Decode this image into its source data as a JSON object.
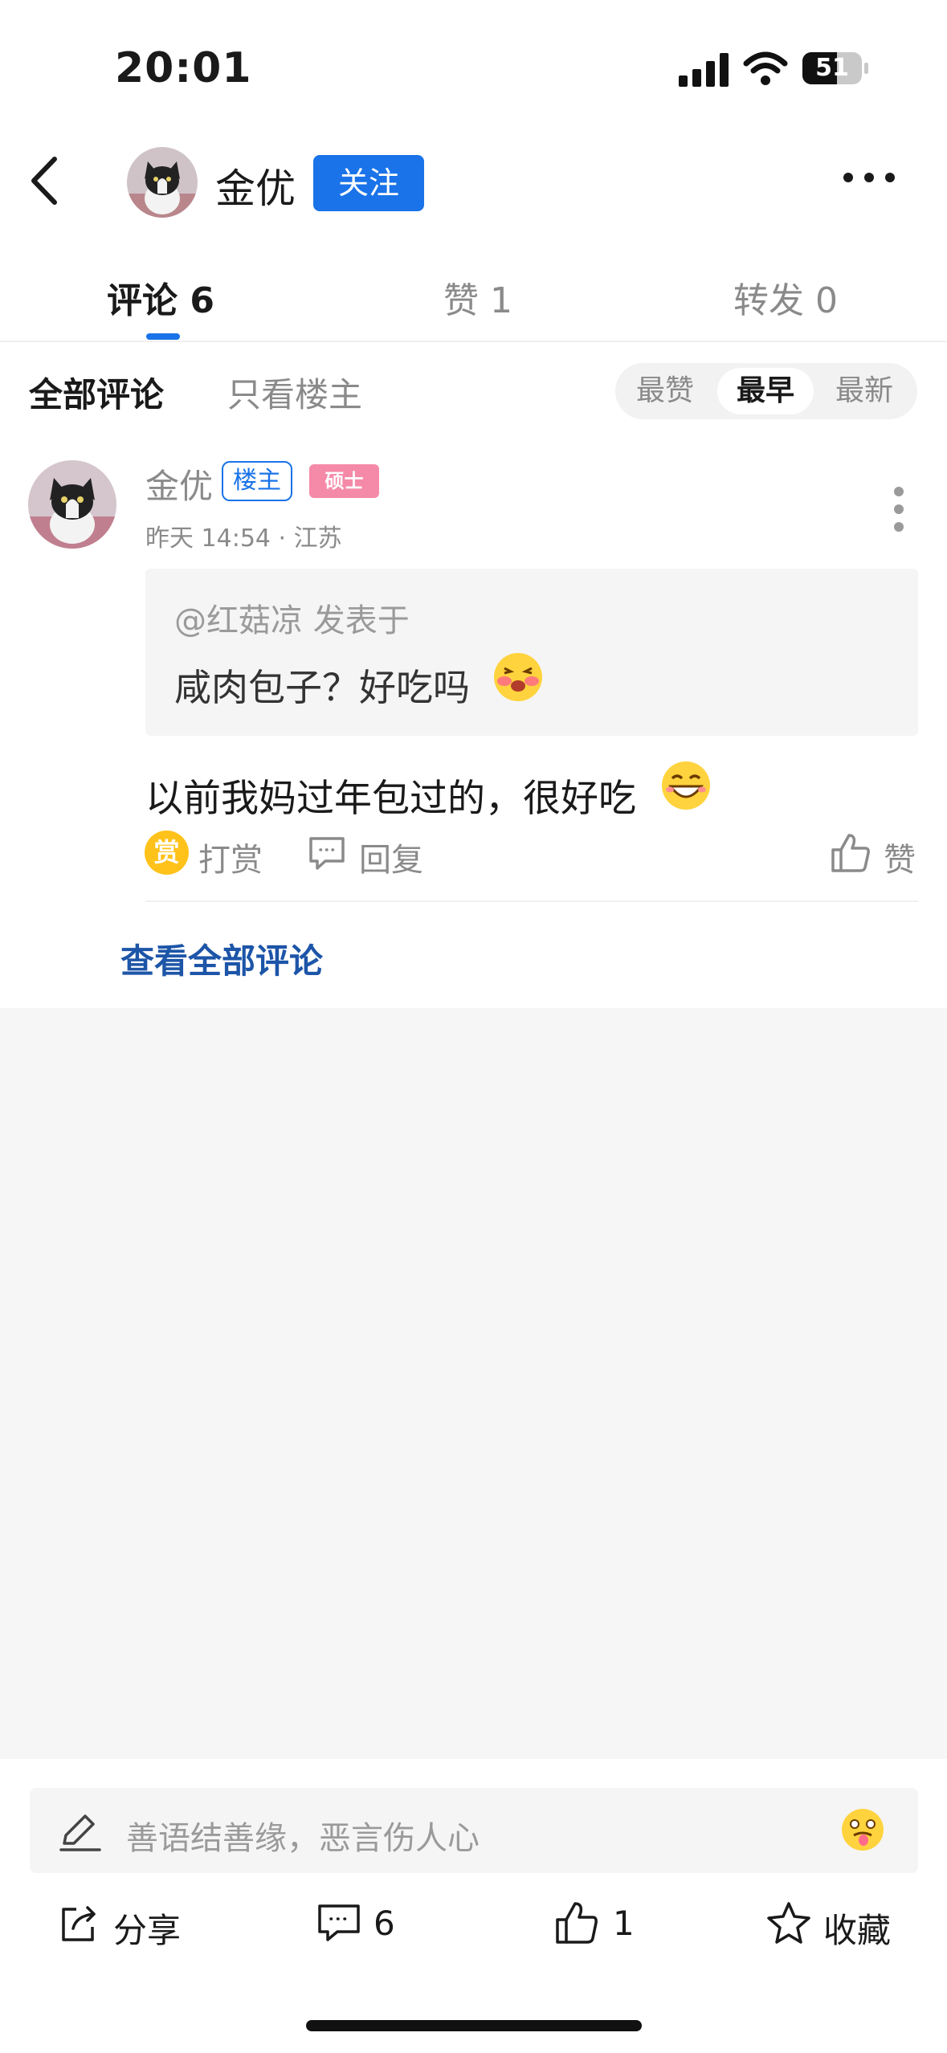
{
  "status_bar": {
    "time": "20:01",
    "battery": "51"
  },
  "header": {
    "username": "金优",
    "follow_label": "关注"
  },
  "tabs": [
    {
      "label": "评论 6"
    },
    {
      "label": "赞 1"
    },
    {
      "label": "转发 0"
    }
  ],
  "filters": {
    "all_label": "全部评论",
    "owner_only_label": "只看楼主",
    "sort_options": [
      "最赞",
      "最早",
      "最新"
    ],
    "active_sort": "最早"
  },
  "comment": {
    "author": "金优",
    "owner_badge": "楼主",
    "degree_badge": "硕士",
    "time_location": "昨天 14:54 · 江苏",
    "quote_author": "@红菇凉 发表于",
    "quote_text": "咸肉包子？好吃吗",
    "body": "以前我妈过年包过的，很好吃",
    "reward_icon_char": "赏",
    "reward_label": "打赏",
    "reply_label": "回复",
    "like_label": "赞"
  },
  "view_all_label": "查看全部评论",
  "input": {
    "placeholder": "善语结善缘，恶言伤人心"
  },
  "bottom_actions": {
    "share_label": "分享",
    "comment_count": "6",
    "like_count": "1",
    "favorite_label": "收藏"
  },
  "colors": {
    "accent": "#1a73e8",
    "link": "#1d55a8",
    "degree_badge": "#f58aa8",
    "reward": "#ffc21a"
  }
}
